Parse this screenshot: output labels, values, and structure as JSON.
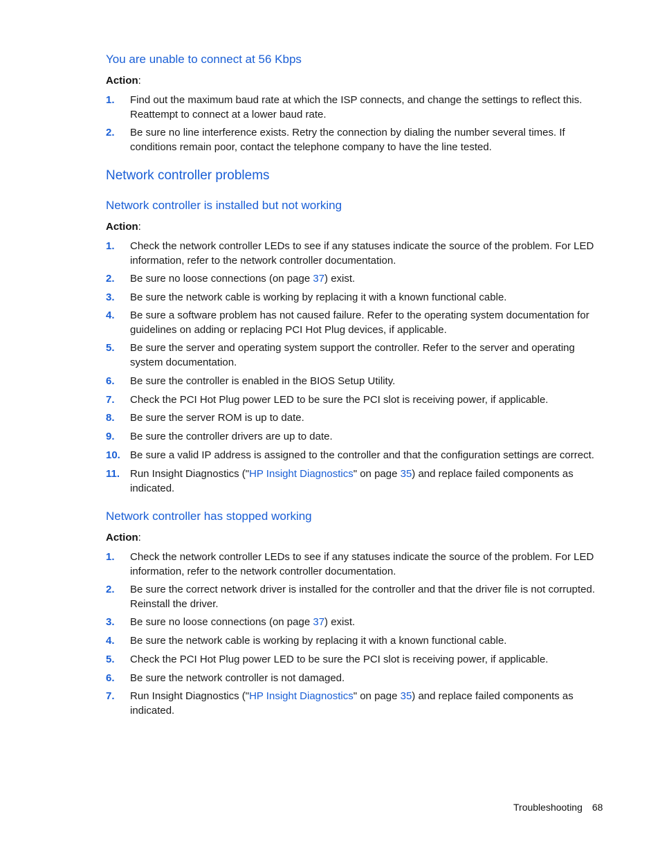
{
  "section1": {
    "title": "You are unable to connect at 56 Kbps",
    "action_label": "Action",
    "items": [
      {
        "num": "1.",
        "text": "Find out the maximum baud rate at which the ISP connects, and change the settings to reflect this. Reattempt to connect at a lower baud rate."
      },
      {
        "num": "2.",
        "text": "Be sure no line interference exists. Retry the connection by dialing the number several times. If conditions remain poor, contact the telephone company to have the line tested."
      }
    ]
  },
  "section2": {
    "title": "Network controller problems"
  },
  "section3": {
    "title": "Network controller is installed but not working",
    "action_label": "Action",
    "items": [
      {
        "num": "1.",
        "text": "Check the network controller LEDs to see if any statuses indicate the source of the problem. For LED information, refer to the network controller documentation."
      },
      {
        "num": "2.",
        "pre": "Be sure no loose connections (on page ",
        "link": "37",
        "post": ") exist."
      },
      {
        "num": "3.",
        "text": "Be sure the network cable is working by replacing it with a known functional cable."
      },
      {
        "num": "4.",
        "text": "Be sure a software problem has not caused failure. Refer to the operating system documentation for guidelines on adding or replacing PCI Hot Plug devices, if applicable."
      },
      {
        "num": "5.",
        "text": "Be sure the server and operating system support the controller. Refer to the server and operating system documentation."
      },
      {
        "num": "6.",
        "text": "Be sure the controller is enabled in the BIOS Setup Utility."
      },
      {
        "num": "7.",
        "text": "Check the PCI Hot Plug power LED to be sure the PCI slot is receiving power, if applicable."
      },
      {
        "num": "8.",
        "text": "Be sure the server ROM is up to date."
      },
      {
        "num": "9.",
        "text": "Be sure the controller drivers are up to date."
      },
      {
        "num": "10.",
        "text": "Be sure a valid IP address is assigned to the controller and that the configuration settings are correct."
      },
      {
        "num": "11.",
        "pre": "Run Insight Diagnostics (\"",
        "link": "HP Insight Diagnostics",
        "mid": "\" on page ",
        "link2": "35",
        "post": ") and replace failed components as indicated."
      }
    ]
  },
  "section4": {
    "title": "Network controller has stopped working",
    "action_label": "Action",
    "items": [
      {
        "num": "1.",
        "text": "Check the network controller LEDs to see if any statuses indicate the source of the problem. For LED information, refer to the network controller documentation."
      },
      {
        "num": "2.",
        "text": "Be sure the correct network driver is installed for the controller and that the driver file is not corrupted. Reinstall the driver."
      },
      {
        "num": "3.",
        "pre": "Be sure no loose connections (on page ",
        "link": "37",
        "post": ") exist."
      },
      {
        "num": "4.",
        "text": "Be sure the network cable is working by replacing it with a known functional cable."
      },
      {
        "num": "5.",
        "text": "Check the PCI Hot Plug power LED to be sure the PCI slot is receiving power, if applicable."
      },
      {
        "num": "6.",
        "text": "Be sure the network controller is not damaged."
      },
      {
        "num": "7.",
        "pre": "Run Insight Diagnostics (\"",
        "link": "HP Insight Diagnostics",
        "mid": "\" on page ",
        "link2": "35",
        "post": ") and replace failed components as indicated."
      }
    ]
  },
  "footer": {
    "section": "Troubleshooting",
    "page": "68"
  },
  "colors": {
    "heading": "#1a5fd6",
    "link": "#1a5fd6",
    "text": "#1a1a1a"
  }
}
